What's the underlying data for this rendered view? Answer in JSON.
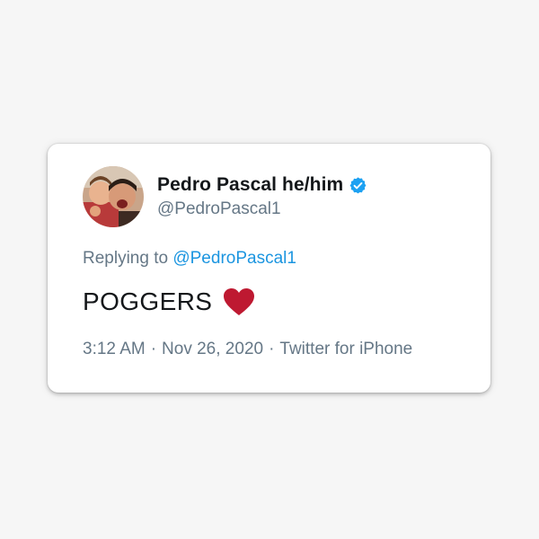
{
  "tweet": {
    "display_name": "Pedro Pascal he/him",
    "handle": "@PedroPascal1",
    "verified_icon": "verified-badge-icon",
    "replying_prefix": "Replying to",
    "replying_to": "@PedroPascal1",
    "text": "POGGERS",
    "emoji": "heart-icon",
    "time": "3:12 AM",
    "date": "Nov 26, 2020",
    "source": "Twitter for iPhone",
    "separator": "·"
  },
  "colors": {
    "background": "#f6f6f6",
    "card": "#ffffff",
    "name": "#14171a",
    "muted": "#657786",
    "link": "#1b95e0",
    "verified": "#1da1f2",
    "heart": "#be1931"
  }
}
